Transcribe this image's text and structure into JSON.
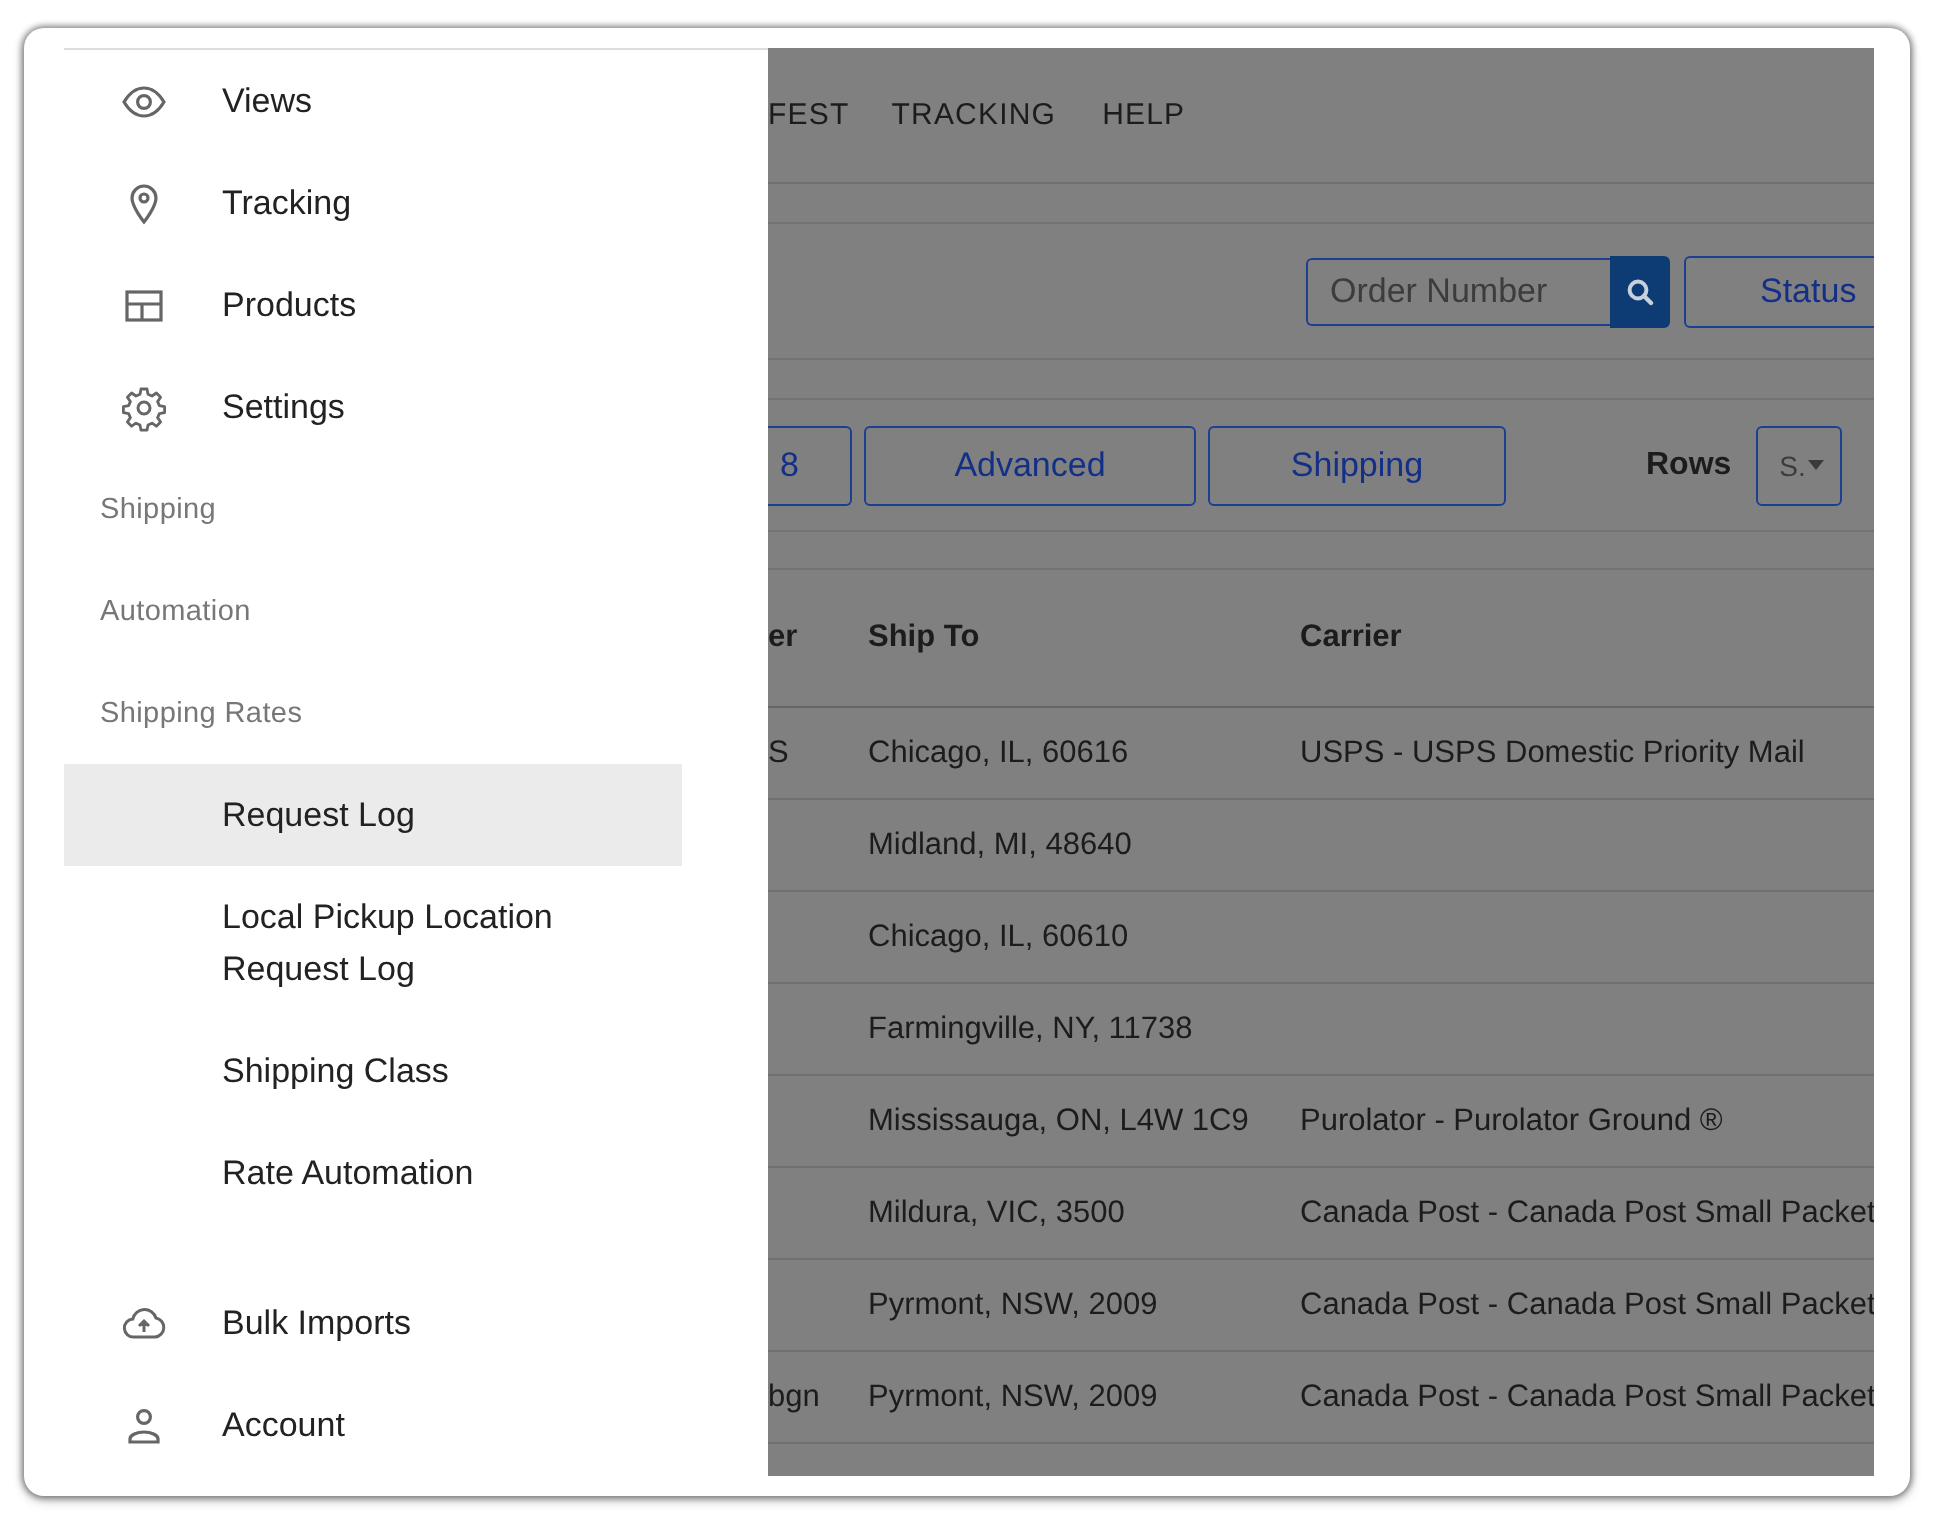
{
  "drawer": {
    "items": [
      {
        "kind": "link",
        "label": "Views",
        "selected": false
      },
      {
        "kind": "link",
        "label": "Tracking",
        "selected": false
      },
      {
        "kind": "link",
        "label": "Products",
        "selected": false
      },
      {
        "kind": "link",
        "label": "Settings",
        "selected": false
      },
      {
        "kind": "section",
        "label": "Shipping"
      },
      {
        "kind": "section",
        "label": "Automation"
      },
      {
        "kind": "section",
        "label": "Shipping Rates",
        "children": [
          {
            "label": "Request Log",
            "selected": true
          },
          {
            "label": "Local Pickup Location Request Log",
            "selected": false
          },
          {
            "label": "Shipping Class",
            "selected": false
          },
          {
            "label": "Rate Automation",
            "selected": false
          }
        ]
      }
    ],
    "footer_items": [
      {
        "label": "Bulk Imports",
        "selected": false
      },
      {
        "label": "Account",
        "selected": false
      }
    ]
  },
  "nav": [
    {
      "label": "FEST"
    },
    {
      "label": "TRACKING"
    },
    {
      "label": "HELP"
    }
  ],
  "search": {
    "placeholder": "Order Number"
  },
  "status_button": "Status",
  "filter_buttons": [
    "8",
    "Advanced",
    "Shipping"
  ],
  "rows_label": "Rows",
  "rows_select": "S.",
  "table": {
    "columns": [
      "er",
      "Ship To",
      "Carrier"
    ],
    "rows": [
      [
        "S",
        "Chicago, IL, 60616",
        "USPS - USPS Domestic Priority Mail"
      ],
      [
        "",
        "Midland, MI, 48640",
        ""
      ],
      [
        "",
        "Chicago, IL, 60610",
        ""
      ],
      [
        "",
        "Farmingville, NY, 11738",
        ""
      ],
      [
        "",
        "Mississauga, ON, L4W 1C9",
        "Purolator - Purolator Ground ®"
      ],
      [
        "",
        "Mildura, VIC, 3500",
        "Canada Post - Canada Post Small Packet"
      ],
      [
        "",
        "Pyrmont, NSW, 2009",
        "Canada Post - Canada Post Small Packet"
      ],
      [
        "bgn",
        "Pyrmont, NSW, 2009",
        "Canada Post - Canada Post Small Packet"
      ]
    ]
  }
}
